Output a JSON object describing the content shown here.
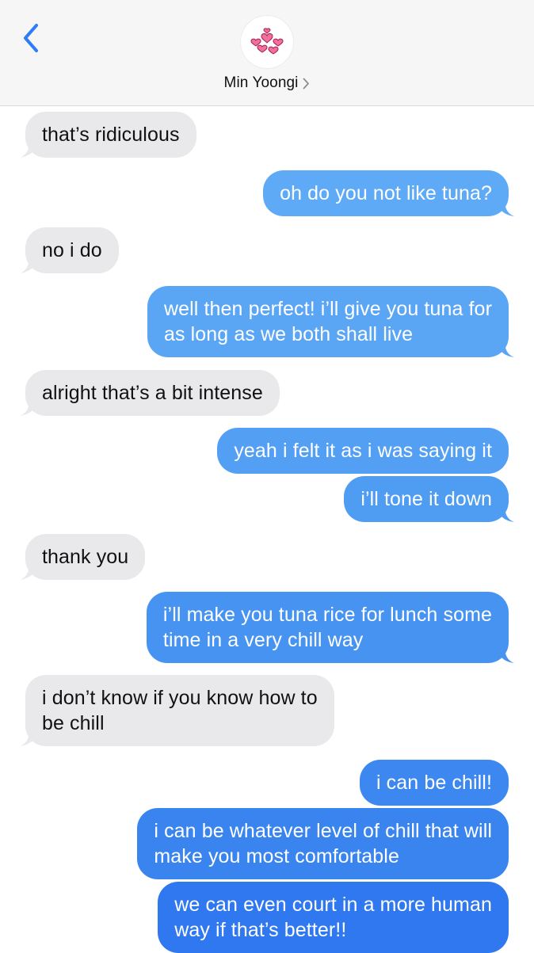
{
  "header": {
    "contact_name": "Min Yoongi",
    "back_icon": "chevron-left-icon",
    "avatar_icon": "hearts-icon",
    "accent_color": "#2f7cf6"
  },
  "messages": [
    {
      "from": "them",
      "text": "that’s ridiculous"
    },
    {
      "from": "me",
      "text": "oh do you not like tuna?"
    },
    {
      "from": "them",
      "text": "no i do"
    },
    {
      "from": "me",
      "line1": "well then perfect! i’ll give you tuna for",
      "line2": "as long as we both shall live"
    },
    {
      "from": "them",
      "text": "alright that’s a bit intense"
    },
    {
      "from": "me",
      "text": "yeah i felt it as i was saying it"
    },
    {
      "from": "me",
      "text": "i’ll tone it down"
    },
    {
      "from": "them",
      "text": "thank you"
    },
    {
      "from": "me",
      "line1": "i’ll make you tuna rice for lunch some",
      "line2": "time in a very chill way"
    },
    {
      "from": "them",
      "line1": "i don’t know if you know how to",
      "line2": "be chill"
    },
    {
      "from": "me",
      "text": "i can be chill!"
    },
    {
      "from": "me",
      "line1": "i can be whatever level of chill that will",
      "line2": "make you most comfortable"
    },
    {
      "from": "me",
      "line1": "we can even court in a more human",
      "line2": "way if that’s better!!"
    }
  ],
  "colors": {
    "received_bubble": "#e9e9eb",
    "sent_bubble_light": "#5eaaf6",
    "sent_bubble_dark": "#2f78ef"
  }
}
